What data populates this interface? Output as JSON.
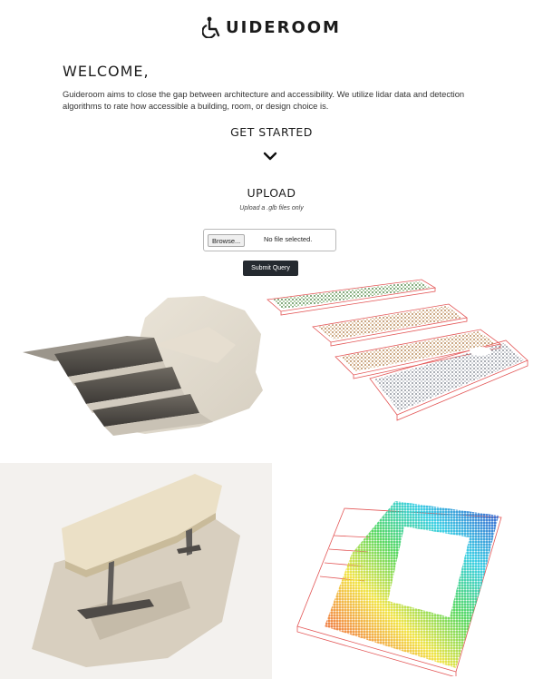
{
  "brand": {
    "name": "UIDEROOM",
    "icon": "accessibility-wheelchair-g-icon"
  },
  "welcome": {
    "title": "WELCOME,",
    "description": "Guideroom aims to close the gap between architecture and accessibility. We utilize lidar data and detection algorithms to rate how accessible a building, room, or design choice is."
  },
  "get_started": {
    "label": "GET STARTED",
    "icon": "chevron-down-icon"
  },
  "upload": {
    "title": "UPLOAD",
    "note": "Upload a .glb files only",
    "browse_label": "Browse...",
    "file_status": "No file selected.",
    "submit_label": "Submit Query"
  },
  "colors": {
    "button_dark": "#252a30",
    "layer_green": "#3a7a2a",
    "layer_tan": "#b07a3a",
    "layer_gray": "#8a8e96",
    "bbox_red": "#e04a4a"
  }
}
